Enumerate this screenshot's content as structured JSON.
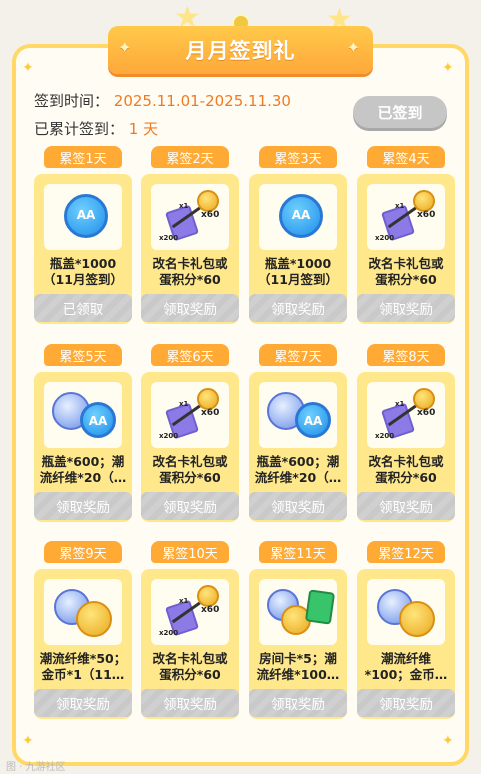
{
  "title": "月月签到礼",
  "sign_period_label": "签到时间：",
  "sign_period_value": "2025.11.01-2025.11.30",
  "cumulative_label": "已累计签到：",
  "cumulative_value": "1 天",
  "signed_button": "已签到",
  "days": [
    {
      "tag": "累签1天",
      "reward": "瓶盖*1000\n（11月签到）",
      "button": "已领取",
      "icon": "bottle-cap"
    },
    {
      "tag": "累签2天",
      "reward": "改名卡礼包或\n蛋积分*60",
      "button": "领取奖励",
      "icon": "rename-card-or-egg"
    },
    {
      "tag": "累签3天",
      "reward": "瓶盖*1000\n（11月签到）",
      "button": "领取奖励",
      "icon": "bottle-cap"
    },
    {
      "tag": "累签4天",
      "reward": "改名卡礼包或\n蛋积分*60",
      "button": "领取奖励",
      "icon": "rename-card-or-egg"
    },
    {
      "tag": "累签5天",
      "reward": "瓶盖*600；潮\n流纤维*20（…",
      "button": "领取奖励",
      "icon": "cap-and-fiber"
    },
    {
      "tag": "累签6天",
      "reward": "改名卡礼包或\n蛋积分*60",
      "button": "领取奖励",
      "icon": "rename-card-or-egg"
    },
    {
      "tag": "累签7天",
      "reward": "瓶盖*600；潮\n流纤维*20（…",
      "button": "领取奖励",
      "icon": "cap-and-fiber"
    },
    {
      "tag": "累签8天",
      "reward": "改名卡礼包或\n蛋积分*60",
      "button": "领取奖励",
      "icon": "rename-card-or-egg"
    },
    {
      "tag": "累签9天",
      "reward": "潮流纤维*50；\n金币*1（11…",
      "button": "领取奖励",
      "icon": "fiber-and-coin"
    },
    {
      "tag": "累签10天",
      "reward": "改名卡礼包或\n蛋积分*60",
      "button": "领取奖励",
      "icon": "rename-card-or-egg"
    },
    {
      "tag": "累签11天",
      "reward": "房间卡*5；潮\n流纤维*100…",
      "button": "领取奖励",
      "icon": "room-card"
    },
    {
      "tag": "累签12天",
      "reward": "潮流纤维\n*100；金币…",
      "button": "领取奖励",
      "icon": "fiber-and-coin"
    }
  ],
  "watermark": "图 · 九游社区",
  "icon_labels": {
    "x60": "x60",
    "x200": "x200",
    "x1": "x1"
  },
  "colors": {
    "accent": "#ffaa35",
    "card": "#ffe88c",
    "date": "#f07a22",
    "disabled": "#c6c6c6"
  }
}
